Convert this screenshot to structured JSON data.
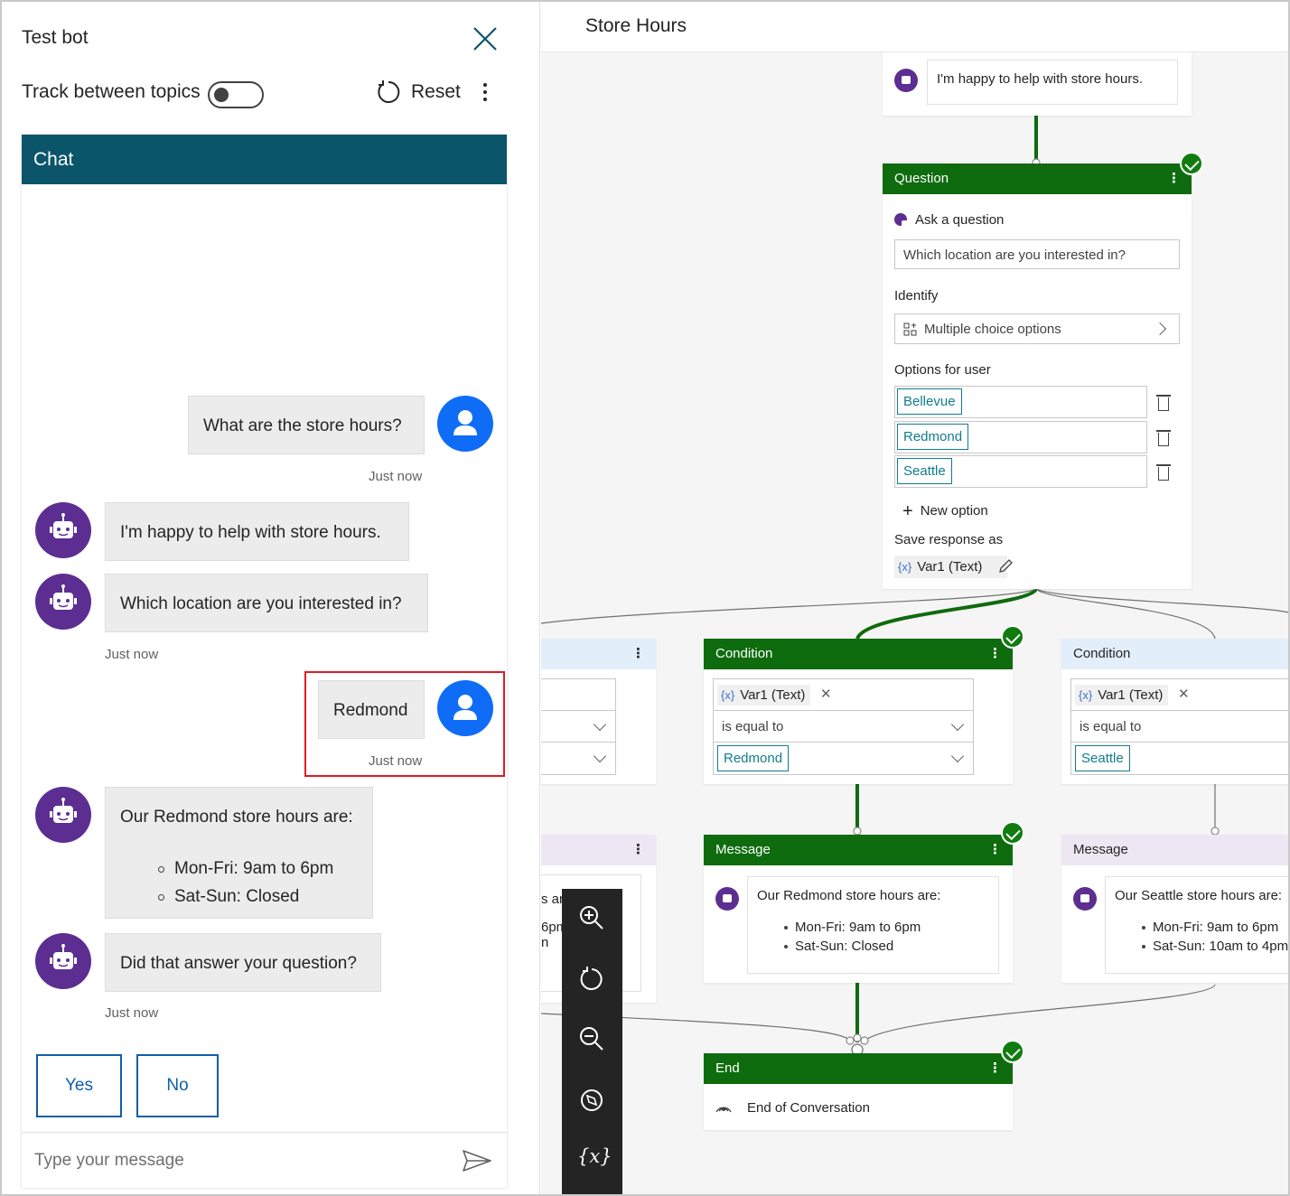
{
  "test_bot": {
    "title": "Test bot",
    "track_label": "Track between topics",
    "reset_label": "Reset",
    "chat_header": "Chat",
    "messages": [
      {
        "from": "user",
        "text": "What are the store hours?",
        "time": "Just now"
      },
      {
        "from": "bot",
        "text": "I'm happy to help with store hours."
      },
      {
        "from": "bot",
        "text": "Which location are you interested in?",
        "time": "Just now"
      },
      {
        "from": "user",
        "text": "Redmond",
        "time": "Just now"
      },
      {
        "from": "bot",
        "text": "Our Redmond store hours are:",
        "items": [
          "Mon-Fri: 9am to 6pm",
          "Sat-Sun: Closed"
        ]
      },
      {
        "from": "bot",
        "text": "Did that answer your question?",
        "time": "Just now"
      }
    ],
    "suggestions": [
      "Yes",
      "No"
    ],
    "input_placeholder": "Type your message"
  },
  "canvas": {
    "title": "Store Hours",
    "greeting": "I'm happy to help with store hours.",
    "question_node": {
      "header": "Question",
      "ask_label": "Ask a question",
      "question_text": "Which location are you interested in?",
      "identify_label": "Identify",
      "identify_value": "Multiple choice options",
      "options_label": "Options for user",
      "options": [
        "Bellevue",
        "Redmond",
        "Seattle"
      ],
      "new_option": "New option",
      "save_label": "Save response as",
      "save_var": "Var1 (Text)"
    },
    "condition_redmond": {
      "header": "Condition",
      "var": "Var1 (Text)",
      "operator": "is equal to",
      "value": "Redmond"
    },
    "condition_seattle": {
      "header": "Condition",
      "var": "Var1 (Text)",
      "operator": "is equal to",
      "value": "Seattle"
    },
    "partial_message": {
      "line1": "s are:",
      "line2": "6pm",
      "line3": "n"
    },
    "message_redmond": {
      "header": "Message",
      "text": "Our Redmond store hours are:",
      "items": [
        "Mon-Fri: 9am to 6pm",
        "Sat-Sun: Closed"
      ]
    },
    "message_seattle": {
      "header": "Message",
      "text": "Our Seattle store hours are:",
      "items": [
        "Mon-Fri: 9am to 6pm",
        "Sat-Sun: 10am to 4pm"
      ]
    },
    "end_node": {
      "header": "End",
      "text": "End of Conversation"
    },
    "var_symbol": "{x}",
    "var_glyph": "{x}"
  },
  "colors": {
    "chat_header": "#0b556a",
    "node_green": "#0e6b0e",
    "bot_purple": "#5c2e91",
    "user_blue": "#0f6cf6",
    "tag_teal": "#117d8e",
    "highlight": "#e01b24"
  }
}
